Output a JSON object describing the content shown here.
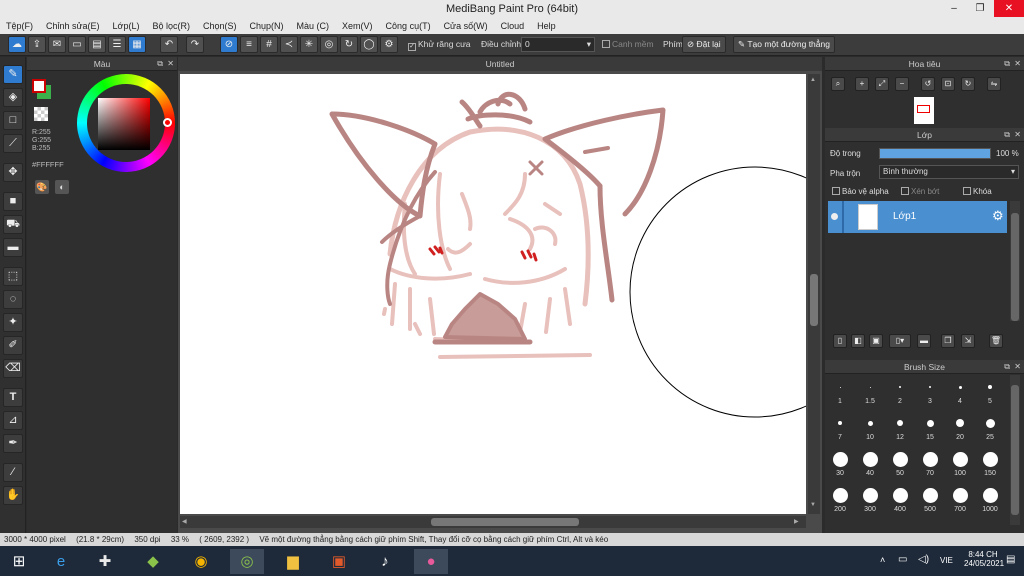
{
  "window": {
    "title": "MediBang Paint Pro (64bit)",
    "minimize": "–",
    "restore": "❐",
    "close": "✕"
  },
  "menu": [
    "Tệp(F)",
    "Chỉnh sửa(E)",
    "Lớp(L)",
    "Bộ lọc(R)",
    "Chọn(S)",
    "Chụp(N)",
    "Màu (C)",
    "Xem(V)",
    "Công cụ(T)",
    "Cửa số(W)",
    "Cloud",
    "Help"
  ],
  "toolbar": {
    "antialias_label": "Khử răng cưa",
    "adjust_label": "Điều chỉnh",
    "adjust_value": "0",
    "snap_label": "Canh mềm",
    "key_label": "Phím",
    "reset_label": "Đặt lại",
    "line_label": "Tạo một đường thẳng"
  },
  "color_panel": {
    "title": "Màu",
    "r": "R:255",
    "g": "G:255",
    "b": "B:255",
    "hex": "#FFFFFF"
  },
  "canvas": {
    "title": "Untitled"
  },
  "navigator": {
    "title": "Hoa tiêu"
  },
  "layer_panel": {
    "title": "Lớp",
    "opacity_label": "Độ trong",
    "opacity_value": "100 %",
    "opacity_fraction": 1.0,
    "blend_label": "Pha trộn",
    "blend_value": "Bình thường",
    "protect_alpha": "Bảo vệ alpha",
    "clip": "Xén bớt",
    "lock": "Khóa",
    "layer_name": "Lớp1"
  },
  "brush_size": {
    "title": "Brush Size",
    "sizes": [
      "1",
      "1.5",
      "2",
      "3",
      "4",
      "5",
      "7",
      "10",
      "12",
      "15",
      "20",
      "25",
      "30",
      "40",
      "50",
      "70",
      "100",
      "150",
      "200",
      "300",
      "400",
      "500",
      "700",
      "1000"
    ]
  },
  "status": {
    "size": "3000 * 4000 pixel",
    "cm": "(21.8 * 29cm)",
    "dpi": "350 dpi",
    "zoom": "33 %",
    "coords": "( 2609, 2392 )",
    "hint": "Vẽ một đường thẳng bằng cách giữ phím Shift, Thay đổi cỡ cọ bằng cách giữ phím Ctrl, Alt và kéo"
  },
  "taskbar": {
    "time": "8:44 CH",
    "date": "24/05/2021",
    "lang": "VIE"
  },
  "colors": {
    "accent": "#2e7bcf",
    "sketch_dark": "#b98583",
    "sketch_light": "#e8c0bc",
    "blush": "#d02020",
    "foreground": "#ffffff",
    "secondary": "#3cb04a"
  }
}
